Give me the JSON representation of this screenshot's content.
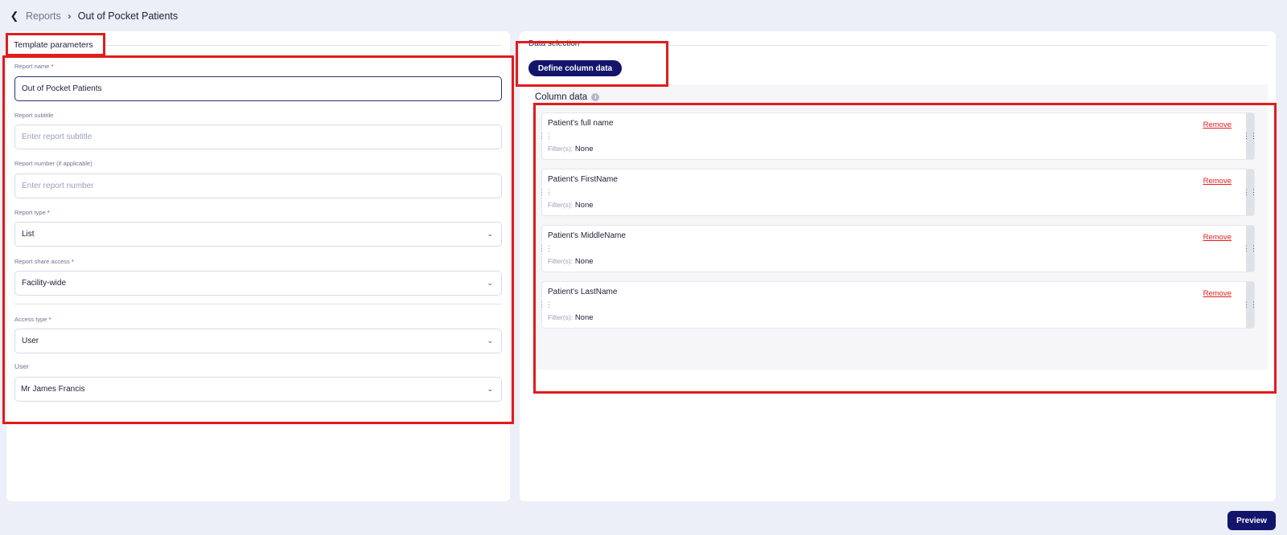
{
  "breadcrumb": {
    "parent": "Reports",
    "current": "Out of Pocket Patients"
  },
  "template": {
    "heading": "Template parameters",
    "fields": {
      "report_name": {
        "label": "Report name",
        "value": "Out of Pocket Patients"
      },
      "report_subtitle": {
        "label": "Report subtitle",
        "placeholder": "Enter report subtitle"
      },
      "report_number": {
        "label": "Report number (if applicable)",
        "placeholder": "Enter report number"
      },
      "report_type": {
        "label": "Report type",
        "value": "List"
      },
      "share_access": {
        "label": "Report share access",
        "value": "Facility-wide"
      },
      "access_type": {
        "label": "Access type",
        "value": "User"
      },
      "user": {
        "label": "User",
        "value": "Mr James Francis"
      }
    }
  },
  "data_selection": {
    "heading": "Data selection",
    "define_button": "Define column data",
    "column_title": "Column data",
    "filter_label": "Filter(s):",
    "remove_label": "Remove",
    "columns": [
      {
        "name": "Patient's full name",
        "filter": "None"
      },
      {
        "name": "Patient's FirstName",
        "filter": "None"
      },
      {
        "name": "Patient's MiddleName",
        "filter": "None"
      },
      {
        "name": "Patient's LastName",
        "filter": "None"
      }
    ]
  },
  "footer": {
    "preview_button": "Preview"
  },
  "colors": {
    "primary": "#13146b",
    "annotation": "#e11c1c",
    "background": "#eceff7"
  }
}
